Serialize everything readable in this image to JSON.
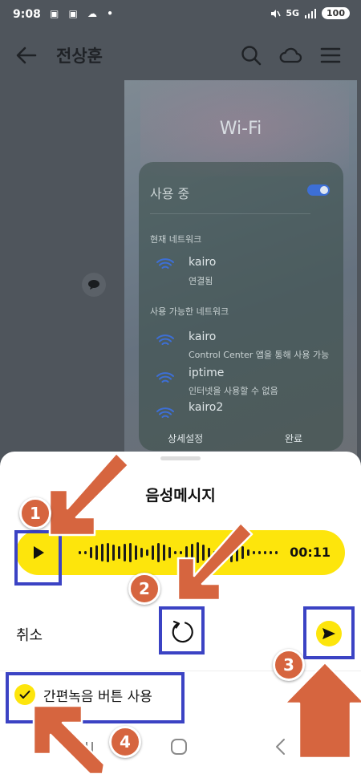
{
  "status_bar": {
    "time": "9:08",
    "left_icons": "▣ ▣ ☁ •",
    "signal_text": "5G",
    "battery": "100"
  },
  "header": {
    "title": "전상훈"
  },
  "wifi_image": {
    "title": "Wi-Fi",
    "in_use_label": "사용 중",
    "current_section": "현재 네트워크",
    "current_network": {
      "name": "kairo",
      "status": "연결됨"
    },
    "available_section": "사용 가능한 네트워크",
    "networks": [
      {
        "name": "kairo",
        "status": "Control Center 앱을 통해 사용 가능"
      },
      {
        "name": "iptime",
        "status": "인터넷을 사용할 수 없음"
      },
      {
        "name": "kairo2",
        "status": ""
      }
    ],
    "detail_label": "상세설정",
    "done_label": "완료"
  },
  "sheet": {
    "title": "음성메시지",
    "duration": "00:11",
    "cancel_label": "취소",
    "easy_record_label": "간편녹음 버튼 사용"
  },
  "annotations": [
    "1",
    "2",
    "3",
    "4"
  ],
  "colors": {
    "accent_yellow": "#fde50c",
    "highlight_blue": "#3b43c4",
    "arrow_orange": "#d6653f"
  }
}
